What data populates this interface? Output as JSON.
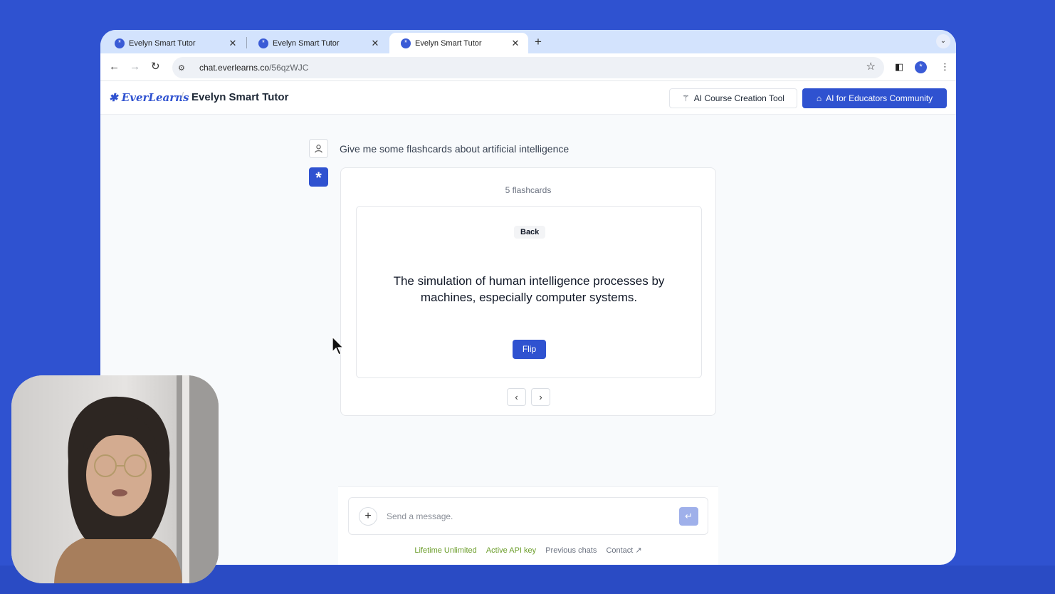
{
  "tabs": [
    {
      "title": "Evelyn Smart Tutor",
      "close": "✕"
    },
    {
      "title": "Evelyn Smart Tutor",
      "close": "✕"
    },
    {
      "title": "Evelyn Smart Tutor",
      "close": "✕"
    }
  ],
  "browser": {
    "new_tab": "+",
    "url_host": "chat.everlearns.co",
    "url_path": "/56qzWJC"
  },
  "app": {
    "brand": "EverLearns",
    "crumb_sep": "/",
    "page_title": "Evelyn Smart Tutor",
    "course_tool_label": "AI Course Creation Tool",
    "community_label": "AI for Educators Community"
  },
  "chat": {
    "user_message": "Give me some flashcards about artificial intelligence"
  },
  "flashcards": {
    "count_label": "5 flashcards",
    "side_label": "Back",
    "card_text": "The simulation of human intelligence processes by machines, especially computer systems.",
    "flip_label": "Flip",
    "prev": "‹",
    "next": "›"
  },
  "composer": {
    "placeholder": "Send a message.",
    "value": ""
  },
  "footer": {
    "lifetime": "Lifetime Unlimited",
    "api_key": "Active API key",
    "previous_chats": "Previous chats",
    "contact": "Contact ↗"
  },
  "colors": {
    "background": "#2f52d0",
    "brand_blue": "#2f52d0",
    "link_green": "#6b9d2a"
  }
}
